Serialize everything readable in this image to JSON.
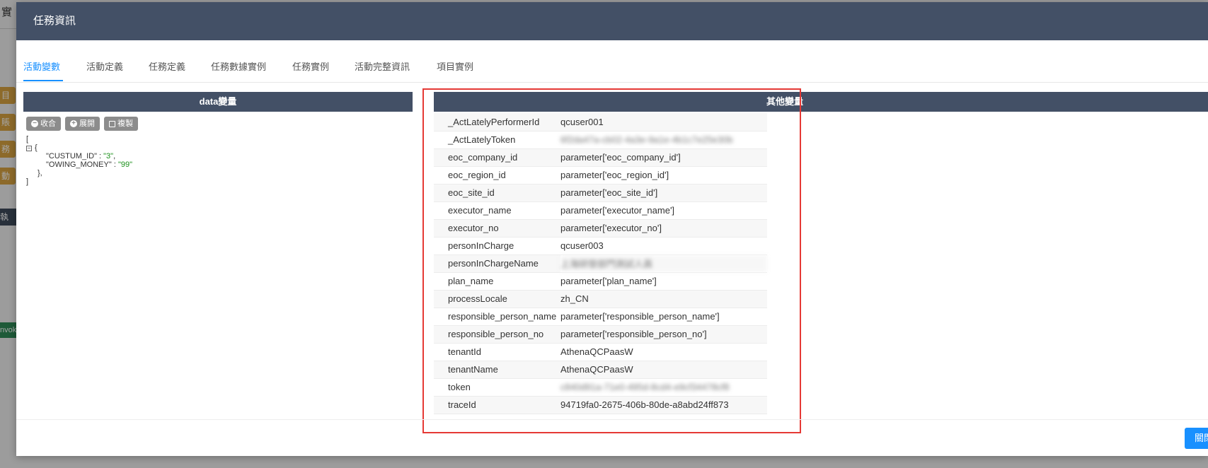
{
  "background": {
    "title_fragment": "實",
    "chips": [
      "目",
      "賬",
      "務",
      "動"
    ],
    "dark_chip": "執",
    "green_chip": "nvok"
  },
  "modal": {
    "title": "任務資訊",
    "tabs": [
      "活動變數",
      "活動定義",
      "任務定義",
      "任務數據實例",
      "任務實例",
      "活動完整資訊",
      "項目實例"
    ],
    "active_tab": "活動變數",
    "left_panel_title": "data變量",
    "right_panel_title": "其他變量",
    "buttons": {
      "collapse": "收合",
      "expand": "展開",
      "copy": "複製"
    },
    "json_view": {
      "open_bracket": "[",
      "open_brace": "{",
      "key1": "\"CUSTUM_ID\"",
      "val1": "\"3\"",
      "key2": "\"OWING_MONEY\"",
      "val2": "\"99\"",
      "close_brace": "},",
      "close_bracket": "]"
    },
    "variables": [
      {
        "key": "_ActLatelyPerformerId",
        "value": "qcuser001",
        "blurred": false
      },
      {
        "key": "_ActLatelyToken",
        "value": "6f2da47a-cb02-4a3e-9a1e-4b1c7e25e30b",
        "blurred": true
      },
      {
        "key": "eoc_company_id",
        "value": "parameter['eoc_company_id']",
        "blurred": false
      },
      {
        "key": "eoc_region_id",
        "value": "parameter['eoc_region_id']",
        "blurred": false
      },
      {
        "key": "eoc_site_id",
        "value": "parameter['eoc_site_id']",
        "blurred": false
      },
      {
        "key": "executor_name",
        "value": "parameter['executor_name']",
        "blurred": false
      },
      {
        "key": "executor_no",
        "value": "parameter['executor_no']",
        "blurred": false
      },
      {
        "key": "personInCharge",
        "value": "qcuser003",
        "blurred": false
      },
      {
        "key": "personInChargeName",
        "value": "上海研發部門測試人員",
        "blurred": true
      },
      {
        "key": "plan_name",
        "value": "parameter['plan_name']",
        "blurred": false
      },
      {
        "key": "processLocale",
        "value": "zh_CN",
        "blurred": false
      },
      {
        "key": "responsible_person_name",
        "value": "parameter['responsible_person_name']",
        "blurred": false
      },
      {
        "key": "responsible_person_no",
        "value": "parameter['responsible_person_no']",
        "blurred": false
      },
      {
        "key": "tenantId",
        "value": "AthenaQCPaasW",
        "blurred": false
      },
      {
        "key": "tenantName",
        "value": "AthenaQCPaasW",
        "blurred": false
      },
      {
        "key": "token",
        "value": "c840d91a-71e0-495d-8cd4-e9cf34478cf8",
        "blurred": true
      },
      {
        "key": "traceId",
        "value": "94719fa0-2675-406b-80de-a8abd24ff873",
        "blurred": false
      }
    ],
    "close_label": "關閉"
  },
  "colors": {
    "header_bg": "#435066",
    "accent": "#1890ff",
    "highlight_border": "#e53935",
    "json_string": "#1a8f1a"
  }
}
